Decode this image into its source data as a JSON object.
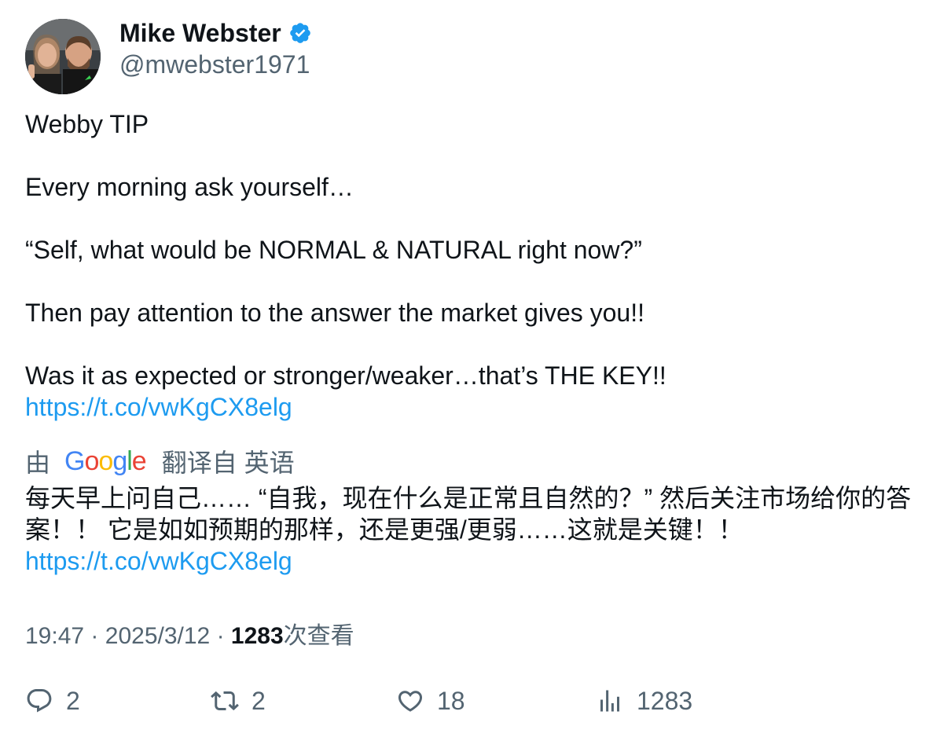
{
  "author": {
    "display_name": "Mike Webster",
    "handle": "@mwebster1971",
    "verified_icon": "verified-badge-icon",
    "verified_color": "#1d9bf0"
  },
  "tweet": {
    "lines": [
      "Webby TIP",
      "",
      "Every morning ask yourself…",
      "",
      "“Self, what would be NORMAL & NATURAL right now?”",
      "",
      "Then pay attention to the answer the market gives you!!",
      "",
      "Was it as expected or stronger/weaker…that’s THE KEY!!"
    ],
    "link": "https://t.co/vwKgCX8elg"
  },
  "translation": {
    "prefix": "由",
    "provider": "Google",
    "suffix": "翻译自 英语",
    "text": "每天早上问自己…… “自我，现在什么是正常且自然的？” 然后关注市场给你的答案！！ 它是如如预期的那样，还是更强/更弱……这就是关键！！",
    "link": "https://t.co/vwKgCX8elg"
  },
  "meta": {
    "time": "19:47",
    "separator": "·",
    "date": "2025/3/12",
    "views_count": "1283",
    "views_label": "次查看"
  },
  "actions": {
    "replies": "2",
    "retweets": "2",
    "likes": "18",
    "views": "1283"
  },
  "colors": {
    "accent": "#1d9bf0",
    "text": "#0f1419",
    "secondary": "#536471"
  }
}
